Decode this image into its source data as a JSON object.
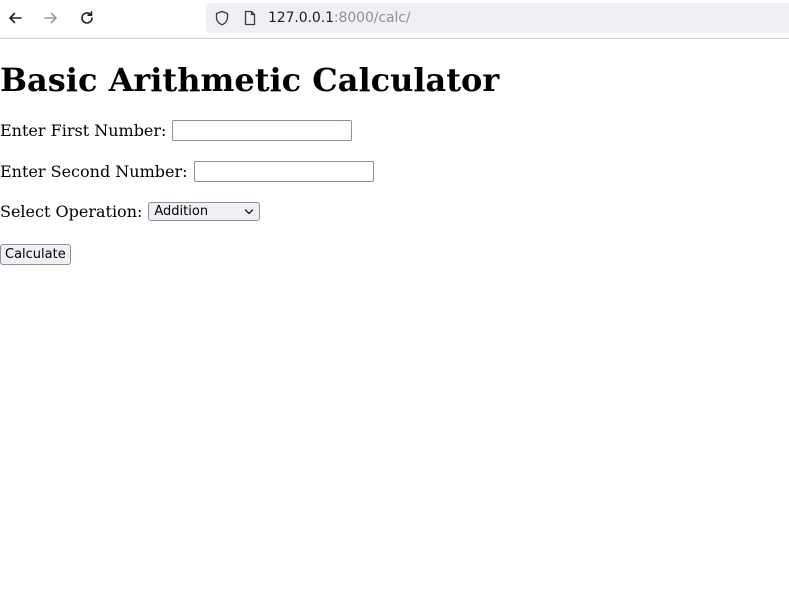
{
  "browser": {
    "url_host": "127.0.0.1",
    "url_rest": ":8000/calc/"
  },
  "page": {
    "title": "Basic Arithmetic Calculator",
    "first_label": "Enter First Number:",
    "first_value": "",
    "second_label": "Enter Second Number:",
    "second_value": "",
    "operation_label": "Select Operation:",
    "operation_selected": "Addition",
    "calculate_label": "Calculate"
  },
  "icons": {
    "back": "arrow-left-icon",
    "forward": "arrow-right-icon",
    "reload": "reload-icon",
    "shield": "shield-icon",
    "page": "page-icon",
    "dropdown": "chevron-down-icon"
  }
}
